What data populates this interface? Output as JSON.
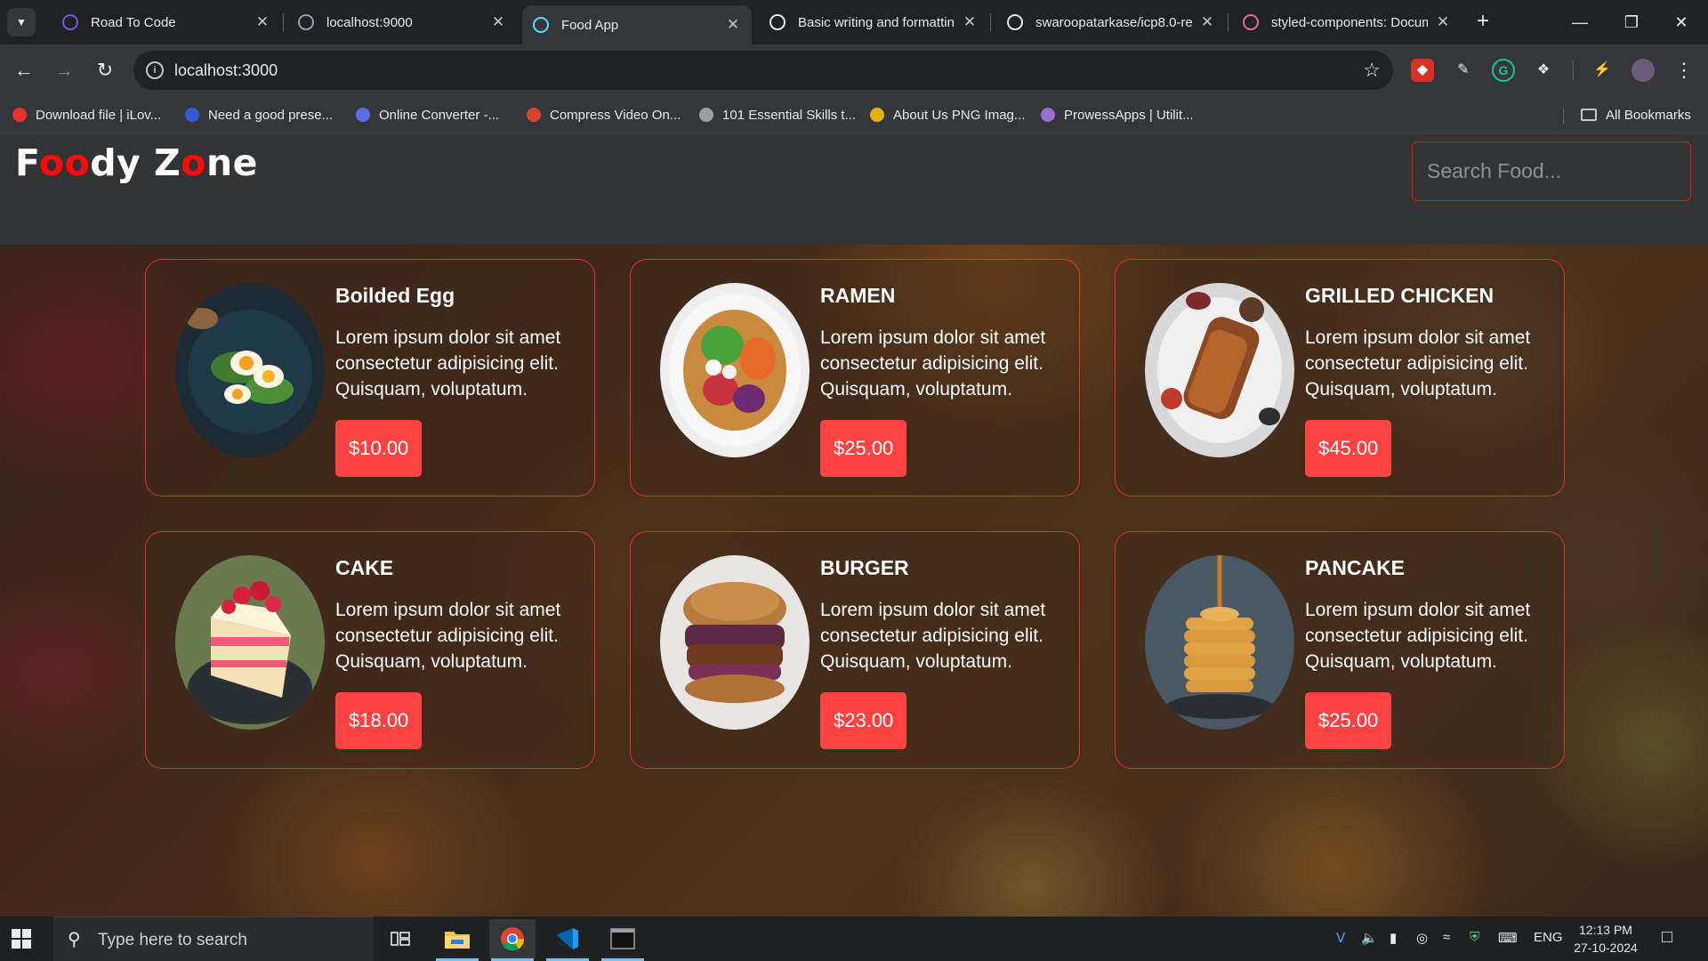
{
  "browser": {
    "tabs": [
      {
        "title": "Road To Code",
        "active": false,
        "icon": "road-to-code-icon"
      },
      {
        "title": "localhost:9000",
        "active": false,
        "icon": "globe-icon"
      },
      {
        "title": "Food App",
        "active": true,
        "icon": "react-icon"
      },
      {
        "title": "Basic writing and formatting",
        "active": false,
        "icon": "github-icon"
      },
      {
        "title": "swaroopatarkase/icp8.0-re",
        "active": false,
        "icon": "github-icon"
      },
      {
        "title": "styled-components: Docum",
        "active": false,
        "icon": "styled-components-icon"
      }
    ],
    "address": "localhost:3000",
    "bookmarks": [
      {
        "label": "Download file | iLov...",
        "color": "#e5322a"
      },
      {
        "label": "Need a good prese...",
        "color": "#2f5bd6"
      },
      {
        "label": "Online Converter -...",
        "color": "#5b6ee8"
      },
      {
        "label": "Compress Video On...",
        "color": "#d9442c"
      },
      {
        "label": "101 Essential Skills t...",
        "color": "#9aa0a6"
      },
      {
        "label": "About Us PNG Imag...",
        "color": "#e8b10f"
      },
      {
        "label": "ProwessApps | Utilit...",
        "color": "#9b6fd0"
      }
    ],
    "all_bookmarks": "All Bookmarks"
  },
  "app": {
    "logo": {
      "parts": [
        {
          "t": "F",
          "red": false
        },
        {
          "t": "oo",
          "red": true
        },
        {
          "t": "dy Z",
          "red": false
        },
        {
          "t": "o",
          "red": true
        },
        {
          "t": "ne",
          "red": false
        }
      ]
    },
    "search_placeholder": "Search Food...",
    "accent": "#ff4343",
    "foods": [
      {
        "name": "Boilded Egg",
        "desc": "Lorem ipsum dolor sit amet consectetur adipisicing elit. Quisquam, voluptatum.",
        "price": "$10.00",
        "img": "egg"
      },
      {
        "name": "RAMEN",
        "desc": "Lorem ipsum dolor sit amet consectetur adipisicing elit. Quisquam, voluptatum.",
        "price": "$25.00",
        "img": "ramen"
      },
      {
        "name": "GRILLED CHICKEN",
        "desc": "Lorem ipsum dolor sit amet consectetur adipisicing elit. Quisquam, voluptatum.",
        "price": "$45.00",
        "img": "chicken"
      },
      {
        "name": "CAKE",
        "desc": "Lorem ipsum dolor sit amet consectetur adipisicing elit. Quisquam, voluptatum.",
        "price": "$18.00",
        "img": "cake"
      },
      {
        "name": "BURGER",
        "desc": "Lorem ipsum dolor sit amet consectetur adipisicing elit. Quisquam, voluptatum.",
        "price": "$23.00",
        "img": "burger"
      },
      {
        "name": "PANCAKE",
        "desc": "Lorem ipsum dolor sit amet consectetur adipisicing elit. Quisquam, voluptatum.",
        "price": "$25.00",
        "img": "pancake"
      }
    ]
  },
  "taskbar": {
    "search_placeholder": "Type here to search",
    "lang": "ENG",
    "time": "12:13 PM",
    "date": "27-10-2024"
  }
}
